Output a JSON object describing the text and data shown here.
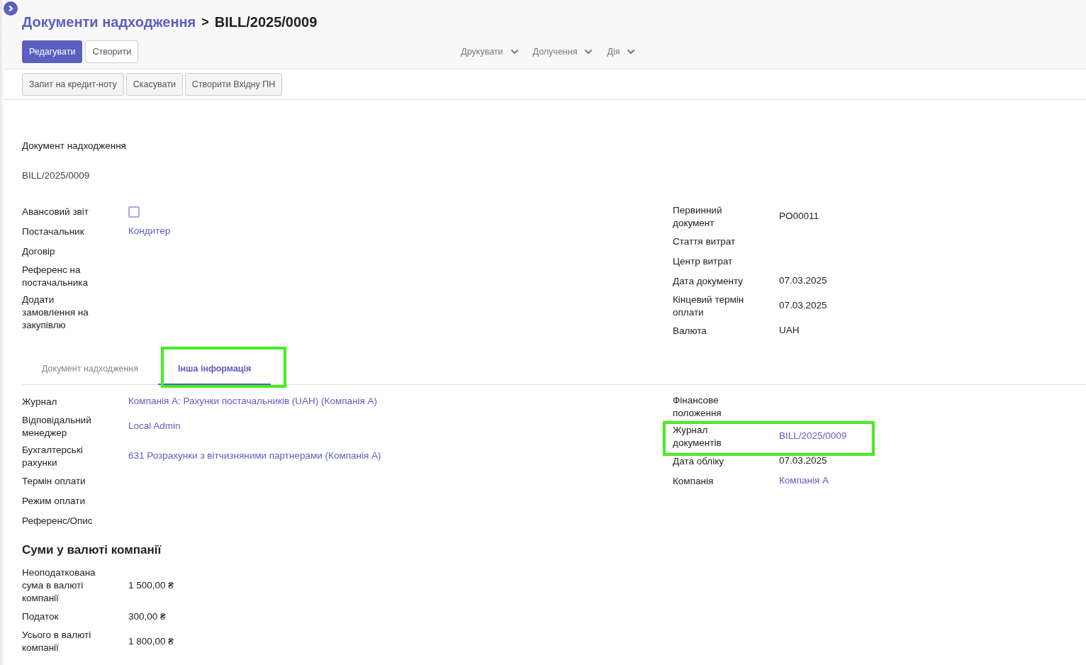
{
  "breadcrumb": {
    "parent": "Документи надходження",
    "separator": ">",
    "current": "BILL/2025/0009"
  },
  "main_buttons": [
    {
      "label": "Редагувати",
      "kind": "primary"
    },
    {
      "label": "Створити",
      "kind": "secondary"
    }
  ],
  "dropdowns": [
    "Друкувати",
    "Долучення",
    "Дія"
  ],
  "status_buttons": [
    "Запит на кредит-ноту",
    "Скасувати",
    "Створити Вхідну ПН"
  ],
  "form": {
    "section_label": "Документ надходження",
    "number": "BILL/2025/0009",
    "left_fields": [
      {
        "label": "Авансовий звіт",
        "kind": "checkbox",
        "checked": false
      },
      {
        "label": "Постачальник",
        "kind": "link",
        "value": "Кондитер"
      },
      {
        "label": "Договір",
        "kind": "empty"
      },
      {
        "label": "Референс на постачальника",
        "kind": "empty"
      },
      {
        "label": "Додати замовлення на закупівлю",
        "kind": "empty"
      }
    ],
    "right_fields": [
      {
        "label": "Первинний документ",
        "kind": "text",
        "value": "PO00011"
      },
      {
        "label": "Стаття витрат",
        "kind": "empty"
      },
      {
        "label": "Центр витрат",
        "kind": "empty"
      },
      {
        "label": "Дата документу",
        "kind": "text",
        "value": "07.03.2025"
      },
      {
        "label": "Кінцевий термін оплати",
        "kind": "text",
        "value": "07.03.2025"
      },
      {
        "label": "Валюта",
        "kind": "text",
        "value": "UAH"
      }
    ]
  },
  "tabs": [
    {
      "label": "Документ надходження",
      "selected": false,
      "highlighted": false
    },
    {
      "label": "Інша інформація",
      "selected": true,
      "highlighted": true
    }
  ],
  "tab_left_fields": [
    {
      "label": "Журнал",
      "kind": "link",
      "value": "Компанія А: Рахунки постачальників (UAH) (Компанія А)",
      "highlighted": false
    },
    {
      "label": "Відповідальний менеджер",
      "kind": "link",
      "value": "Local Admin",
      "highlighted": false
    },
    {
      "label": "Бухгалтерські рахунки",
      "kind": "link",
      "value": "631 Розрахунки з вітчизняними партнерами (Компанія А)",
      "highlighted": false
    },
    {
      "label": "Термін оплати",
      "kind": "empty",
      "highlighted": false
    },
    {
      "label": "Режим оплати",
      "kind": "empty",
      "highlighted": false
    },
    {
      "label": "Референс/Опис",
      "kind": "empty",
      "highlighted": false
    }
  ],
  "tab_right_fields": [
    {
      "label": "Фінансове положення",
      "kind": "empty",
      "highlighted": false
    },
    {
      "label": "Журнал документів",
      "kind": "link",
      "value": "BILL/2025/0009",
      "highlighted": true
    },
    {
      "label": "Дата обліку",
      "kind": "text",
      "value": "07.03.2025",
      "highlighted": false
    },
    {
      "label": "Компанія",
      "kind": "link",
      "value": "Компанія А",
      "highlighted": false
    }
  ],
  "totals": {
    "title": "Суми у валюті компанії",
    "fields": [
      {
        "label": "Неоподаткована сума в валюті компанії",
        "kind": "text",
        "value": "1 500,00 ₴"
      },
      {
        "label": "Податок",
        "kind": "text",
        "value": "300,00 ₴"
      },
      {
        "label": "Усього в валюті компанії",
        "kind": "text",
        "value": "1 800,00 ₴"
      }
    ]
  }
}
